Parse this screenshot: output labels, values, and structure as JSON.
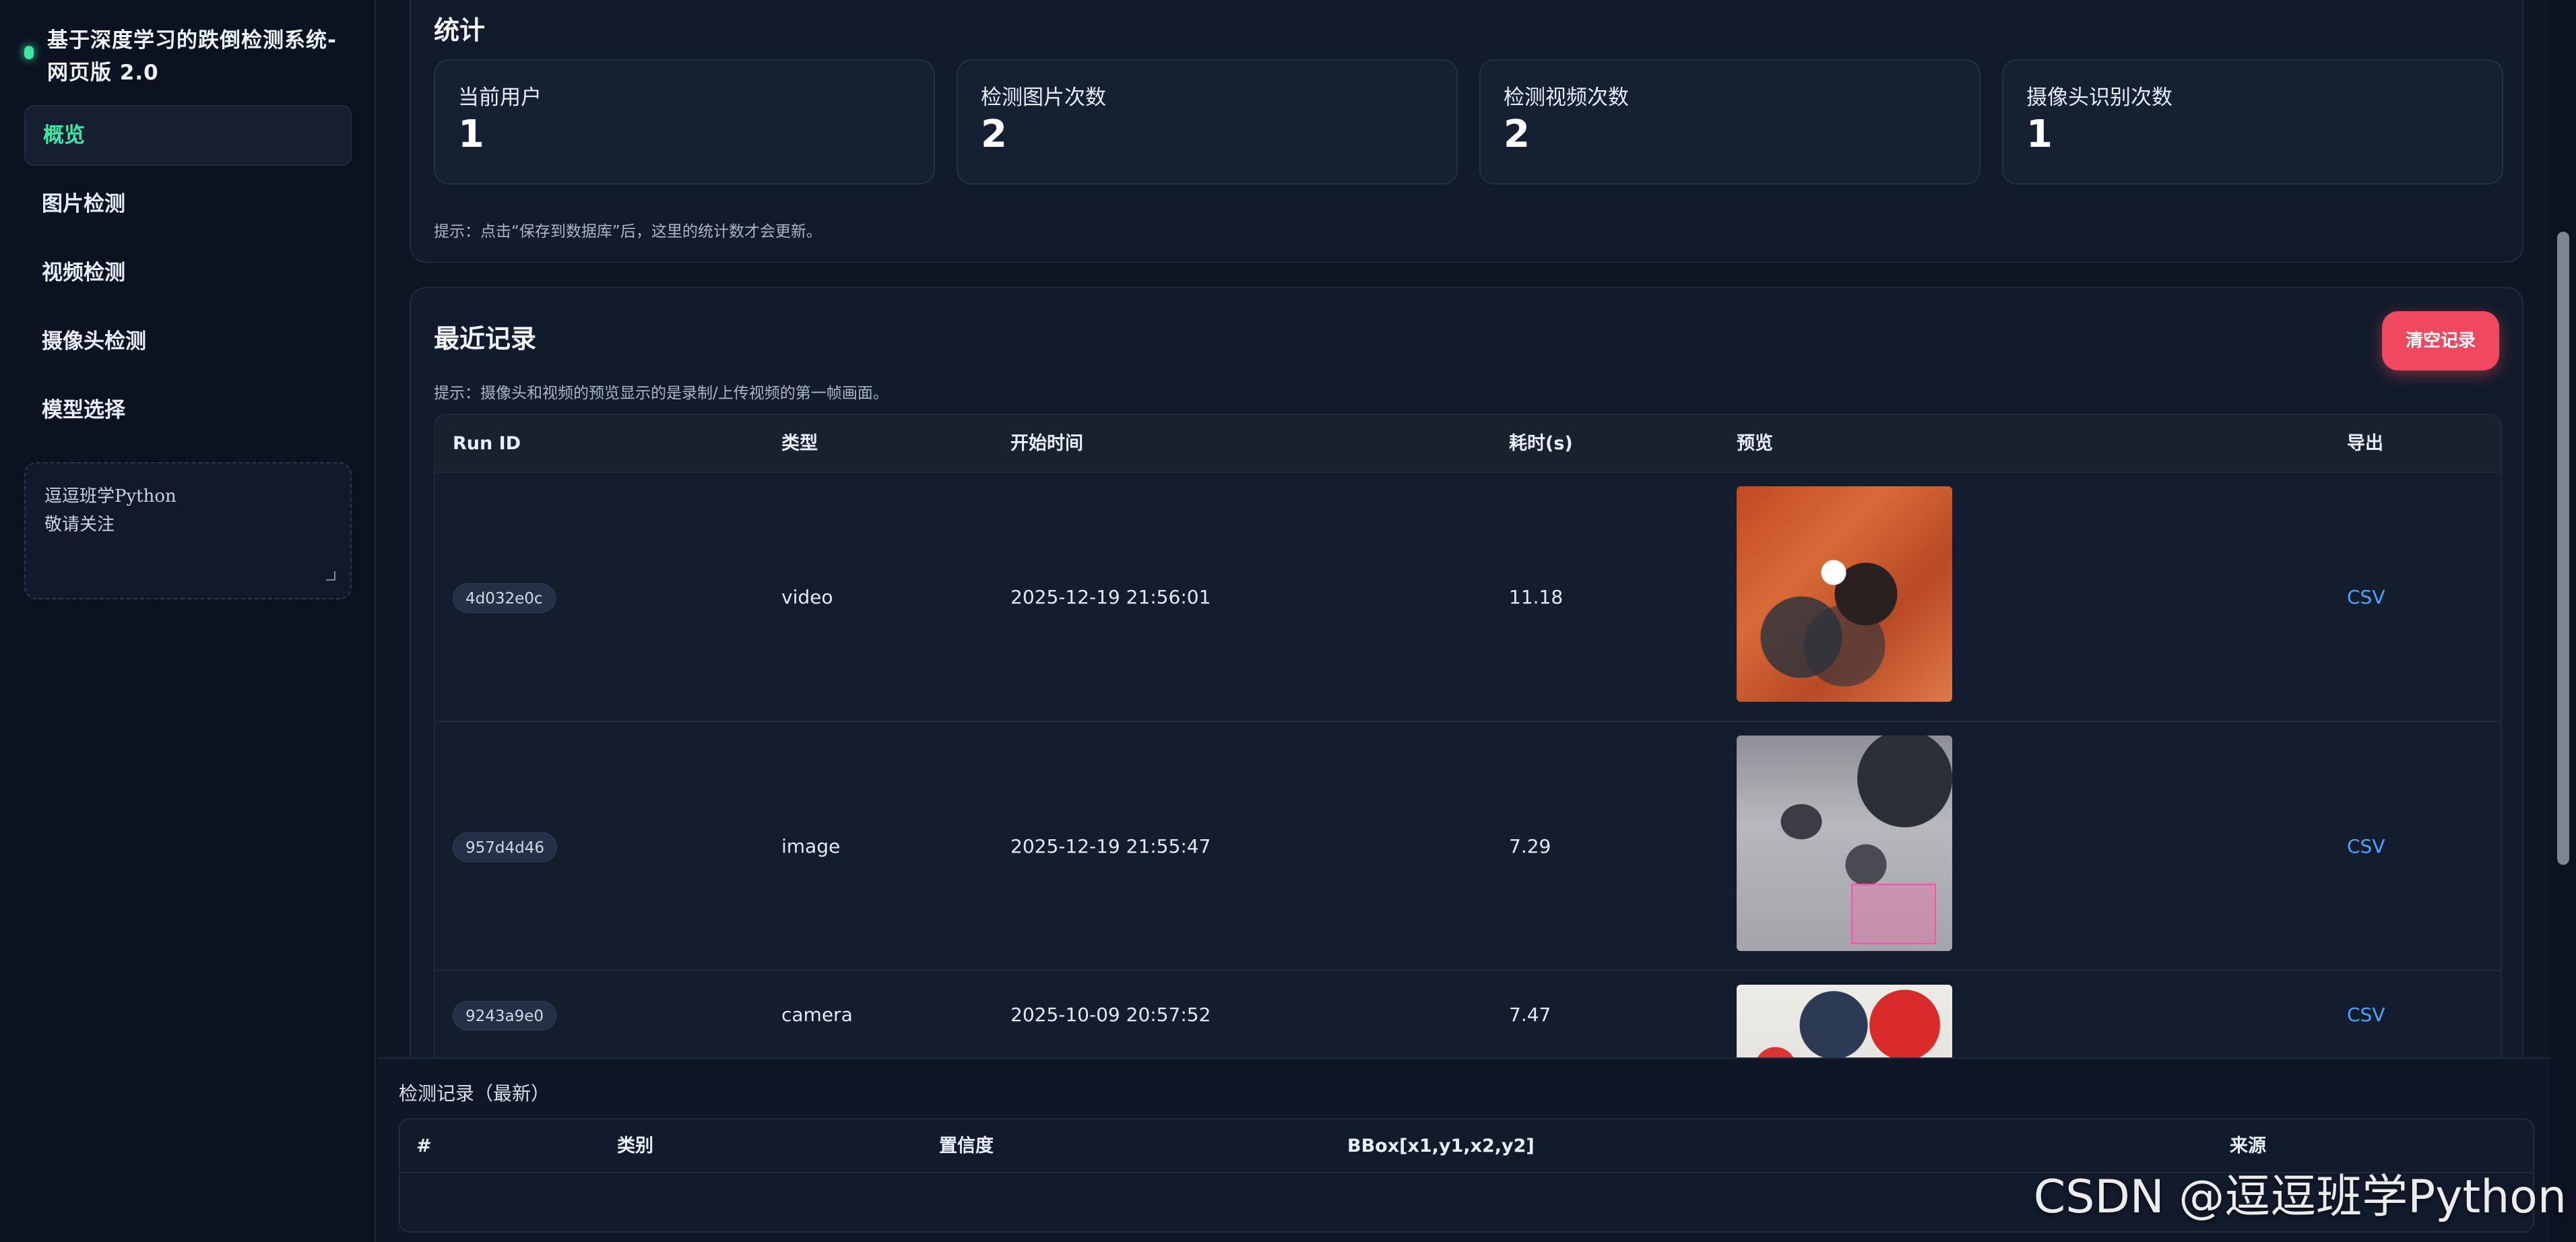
{
  "sidebar": {
    "brand_title": "基于深度学习的跌倒检测系统-网页版 2.0",
    "nav": [
      {
        "label": "概览"
      },
      {
        "label": "图片检测"
      },
      {
        "label": "视频检测"
      },
      {
        "label": "摄像头检测"
      },
      {
        "label": "模型选择"
      }
    ],
    "notes": "逗逗班学Python\n敬请关注"
  },
  "stats": {
    "title": "统计",
    "items": [
      {
        "label": "当前用户",
        "value": "1"
      },
      {
        "label": "检测图片次数",
        "value": "2"
      },
      {
        "label": "检测视频次数",
        "value": "2"
      },
      {
        "label": "摄像头识别次数",
        "value": "1"
      }
    ],
    "hint": "提示：点击“保存到数据库”后，这里的统计数才会更新。"
  },
  "records": {
    "title": "最近记录",
    "clear_label": "清空记录",
    "hint": "提示：摄像头和视频的预览显示的是录制/上传视频的第一帧画面。",
    "columns": [
      "Run ID",
      "类型",
      "开始时间",
      "耗时(s)",
      "预览",
      "导出"
    ],
    "rows": [
      {
        "run_id": "4d032e0c",
        "type": "video",
        "start": "2025-12-19 21:56:01",
        "duration": "11.18",
        "export": "CSV"
      },
      {
        "run_id": "957d4d46",
        "type": "image",
        "start": "2025-12-19 21:55:47",
        "duration": "7.29",
        "export": "CSV"
      },
      {
        "run_id": "9243a9e0",
        "type": "camera",
        "start": "2025-10-09 20:57:52",
        "duration": "7.47",
        "export": "CSV"
      }
    ]
  },
  "detections": {
    "title": "检测记录（最新）",
    "columns": [
      "#",
      "类别",
      "置信度",
      "BBox[x1,y1,x2,y2]",
      "来源"
    ]
  },
  "watermark": "CSDN @逗逗班学Python"
}
